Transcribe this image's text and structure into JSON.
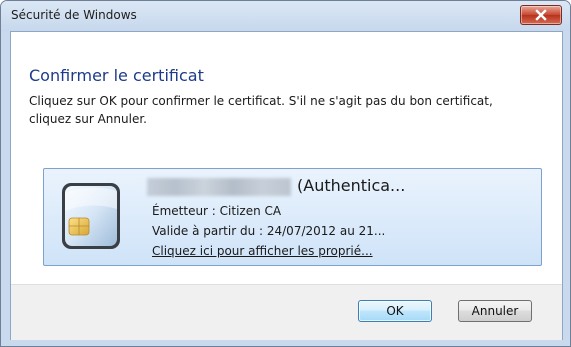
{
  "window": {
    "title": "Sécurité de Windows",
    "close_icon": "close-x-icon"
  },
  "content": {
    "heading": "Confirmer le certificat",
    "description": "Cliquez sur OK pour confirmer le certificat. S'il ne s'agit pas du bon certificat, cliquez sur Annuler."
  },
  "certificate": {
    "icon": "smart-card-icon",
    "name_suffix": "(Authentica...",
    "issuer": "Émetteur : Citizen CA",
    "validity": "Valide à partir du : 24/07/2012 au 21...",
    "properties_link": "Cliquez ici pour afficher les proprié..."
  },
  "buttons": {
    "ok_label": "OK",
    "cancel_label": "Annuler"
  },
  "colors": {
    "heading": "#1e3a8a",
    "close_button": "#c7452f",
    "cert_box": "#cfe3f8"
  }
}
